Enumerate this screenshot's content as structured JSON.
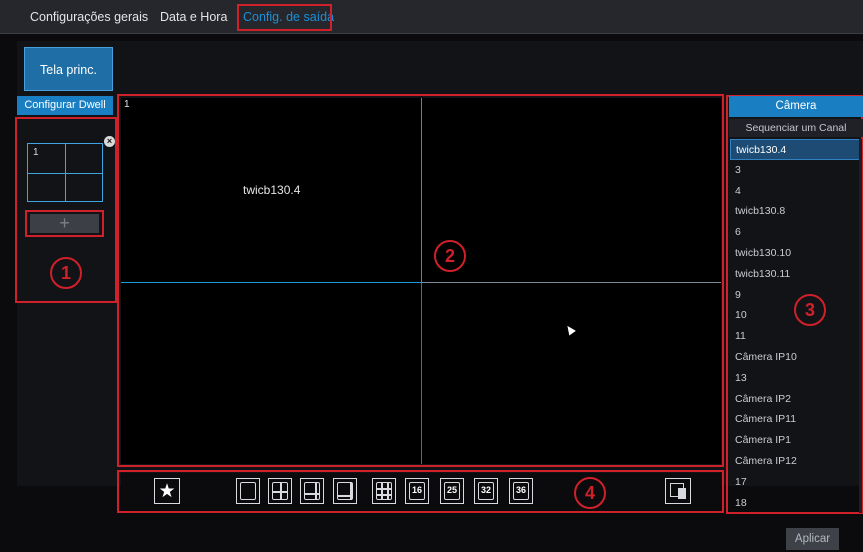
{
  "tabs": [
    {
      "label": "Configurações gerais",
      "active": false
    },
    {
      "label": "Data e Hora",
      "active": false
    },
    {
      "label": "Config. de saída",
      "active": true
    }
  ],
  "main_screen_button": "Tela princ.",
  "dwell": {
    "header": "Configurar Dwell",
    "thumbnail_number": "1",
    "close_glyph": "×",
    "add_glyph": "+"
  },
  "callouts": [
    "1",
    "2",
    "3",
    "4"
  ],
  "preview": {
    "window_number": "1",
    "window_label": "twicb130.4"
  },
  "toolbar": {
    "favorites_icon": "star-icon",
    "layouts": [
      {
        "name": "layout-1",
        "num": ""
      },
      {
        "name": "layout-4",
        "num": ""
      },
      {
        "name": "layout-6",
        "num": ""
      },
      {
        "name": "layout-8",
        "num": ""
      },
      {
        "name": "layout-9",
        "num": ""
      },
      {
        "name": "layout-16",
        "num": "16"
      },
      {
        "name": "layout-25",
        "num": "25"
      },
      {
        "name": "layout-32",
        "num": "32"
      },
      {
        "name": "layout-36",
        "num": "36"
      }
    ],
    "clear_icon": "clear-screen-icon"
  },
  "camera_panel": {
    "header": "Câmera",
    "sequence_label": "Sequenciar um Canal",
    "items": [
      "twicb130.4",
      "3",
      "4",
      "twicb130.8",
      "6",
      "twicb130.10",
      "twicb130.11",
      "9",
      "10",
      "11",
      "Câmera IP10",
      "13",
      "Câmera IP2",
      "Câmera IP11",
      "Câmera IP1",
      "Câmera IP12",
      "17",
      "18"
    ],
    "selected_index": 0
  },
  "apply_button": "Aplicar",
  "colors": {
    "accent": "#1a7fc2",
    "annotation_red": "#d0202a",
    "grid_line": "#1e9ad8"
  }
}
